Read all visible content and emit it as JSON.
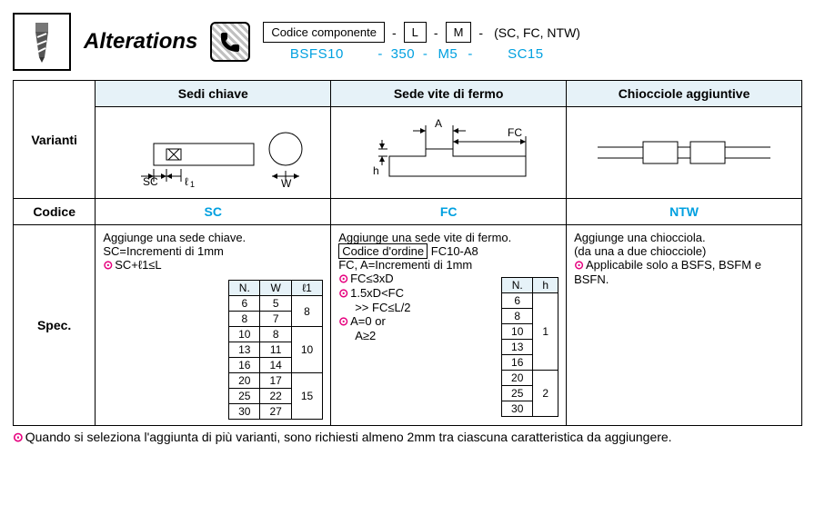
{
  "header": {
    "alt_title": "Alterations",
    "code_label": "Codice componente",
    "L": "L",
    "M": "M",
    "suffix": "(SC, FC, NTW)",
    "example_code": "BSFS10",
    "example_L": "350",
    "example_M": "M5",
    "example_suffix": "SC15"
  },
  "row_labels": {
    "varianti": "Varianti",
    "codice": "Codice",
    "spec": "Spec."
  },
  "cols": {
    "sc": "Sedi chiave",
    "fc": "Sede vite di fermo",
    "ntw": "Chiocciole aggiuntive"
  },
  "codes": {
    "sc": "SC",
    "fc": "FC",
    "ntw": "NTW"
  },
  "diagram_labels": {
    "sc_SC": "SC",
    "sc_l1": "ℓ1",
    "sc_W": "W",
    "fc_A": "A",
    "fc_FC": "FC",
    "fc_h": "h"
  },
  "spec_sc": {
    "l1": "Aggiunge una sede chiave.",
    "l2": "SC=Incrementi di 1mm",
    "l3": "SC+ℓ1≤L",
    "table": {
      "headers": [
        "N.",
        "W",
        "ℓ1"
      ],
      "rows": [
        {
          "n": "6",
          "w": "5",
          "l": "8"
        },
        {
          "n": "8",
          "w": "7",
          "l": "8"
        },
        {
          "n": "10",
          "w": "8",
          "l": "10"
        },
        {
          "n": "13",
          "w": "11",
          "l": "10"
        },
        {
          "n": "16",
          "w": "14",
          "l": "10"
        },
        {
          "n": "20",
          "w": "17",
          "l": "15"
        },
        {
          "n": "25",
          "w": "22",
          "l": "15"
        },
        {
          "n": "30",
          "w": "27",
          "l": "15"
        }
      ]
    }
  },
  "spec_fc": {
    "l1": "Aggiunge una sede vite di fermo.",
    "ordine_label": "Codice d'ordine",
    "ordine_val": "FC10-A8",
    "l3": "FC, A=Incrementi di 1mm",
    "l4": "FC≤3xD",
    "l5a": "1.5xD<FC",
    "l5b": ">>    FC≤L/2",
    "l6a": "A=0 or",
    "l6b": "A≥2",
    "table": {
      "headers": [
        "N.",
        "h"
      ],
      "rows": [
        {
          "n": "6",
          "h": "1"
        },
        {
          "n": "8",
          "h": "1"
        },
        {
          "n": "10",
          "h": "1"
        },
        {
          "n": "13",
          "h": "1"
        },
        {
          "n": "16",
          "h": "1"
        },
        {
          "n": "20",
          "h": "2"
        },
        {
          "n": "25",
          "h": "2"
        },
        {
          "n": "30",
          "h": "2"
        }
      ]
    }
  },
  "spec_ntw": {
    "l1": "Aggiunge una chiocciola.",
    "l2": "(da una a due chiocciole)",
    "l3": "Applicabile solo a BSFS, BSFM e BSFN."
  },
  "footer_note": "Quando si seleziona l'aggiunta di più varianti, sono richiesti almeno 2mm tra ciascuna caratteristica da aggiungere."
}
